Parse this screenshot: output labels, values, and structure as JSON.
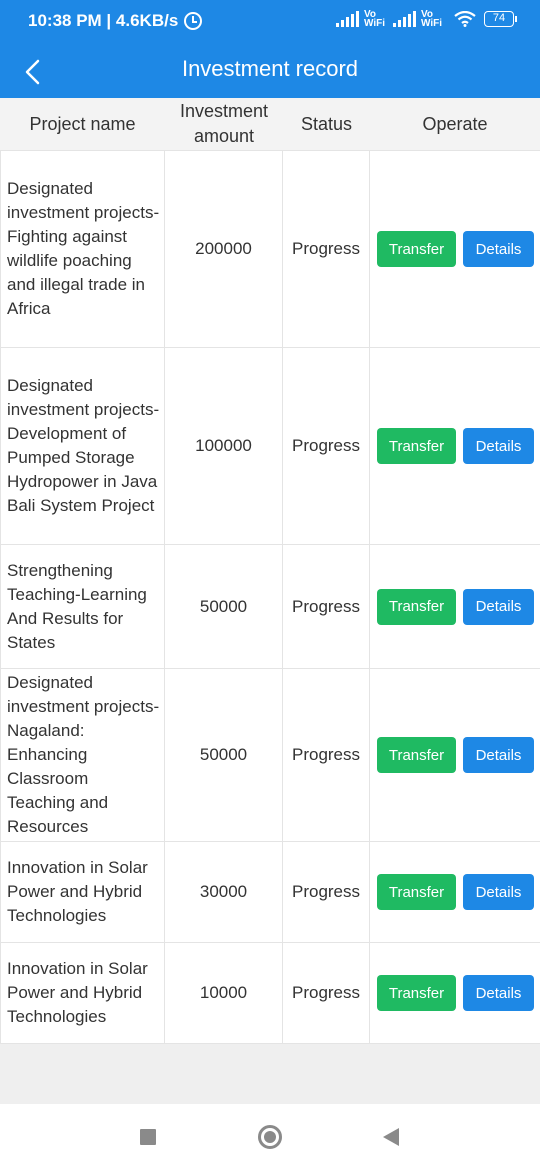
{
  "status_bar": {
    "time_speed": "10:38 PM | 4.6KB/s",
    "vowifi1_top": "Vo",
    "vowifi1_bottom": "WiFi",
    "vowifi2_top": "Vo",
    "vowifi2_bottom": "WiFi",
    "battery": "74"
  },
  "header": {
    "title": "Investment record"
  },
  "table": {
    "columns": [
      "Project name",
      "Investment amount",
      "Status",
      "Operate"
    ],
    "rows": [
      {
        "name": "Designated investment projects-Fighting against wildlife poaching and illegal trade in Africa",
        "amount": "200000",
        "status": "Progress",
        "transfer": "Transfer",
        "details": "Details"
      },
      {
        "name": "Designated investment projects-Development of Pumped Storage Hydropower in Java Bali System Project",
        "amount": "100000",
        "status": "Progress",
        "transfer": "Transfer",
        "details": "Details"
      },
      {
        "name": "Strengthening Teaching-Learning And Results for States",
        "amount": "50000",
        "status": "Progress",
        "transfer": "Transfer",
        "details": "Details"
      },
      {
        "name": "Designated investment projects-Nagaland: Enhancing Classroom Teaching and Resources",
        "amount": "50000",
        "status": "Progress",
        "transfer": "Transfer",
        "details": "Details"
      },
      {
        "name": "Innovation in Solar Power and Hybrid Technologies",
        "amount": "30000",
        "status": "Progress",
        "transfer": "Transfer",
        "details": "Details"
      },
      {
        "name": "Innovation in Solar Power and Hybrid Technologies",
        "amount": "10000",
        "status": "Progress",
        "transfer": "Transfer",
        "details": "Details"
      }
    ]
  },
  "colors": {
    "primary": "#1e88e5",
    "transfer": "#1fba62"
  }
}
